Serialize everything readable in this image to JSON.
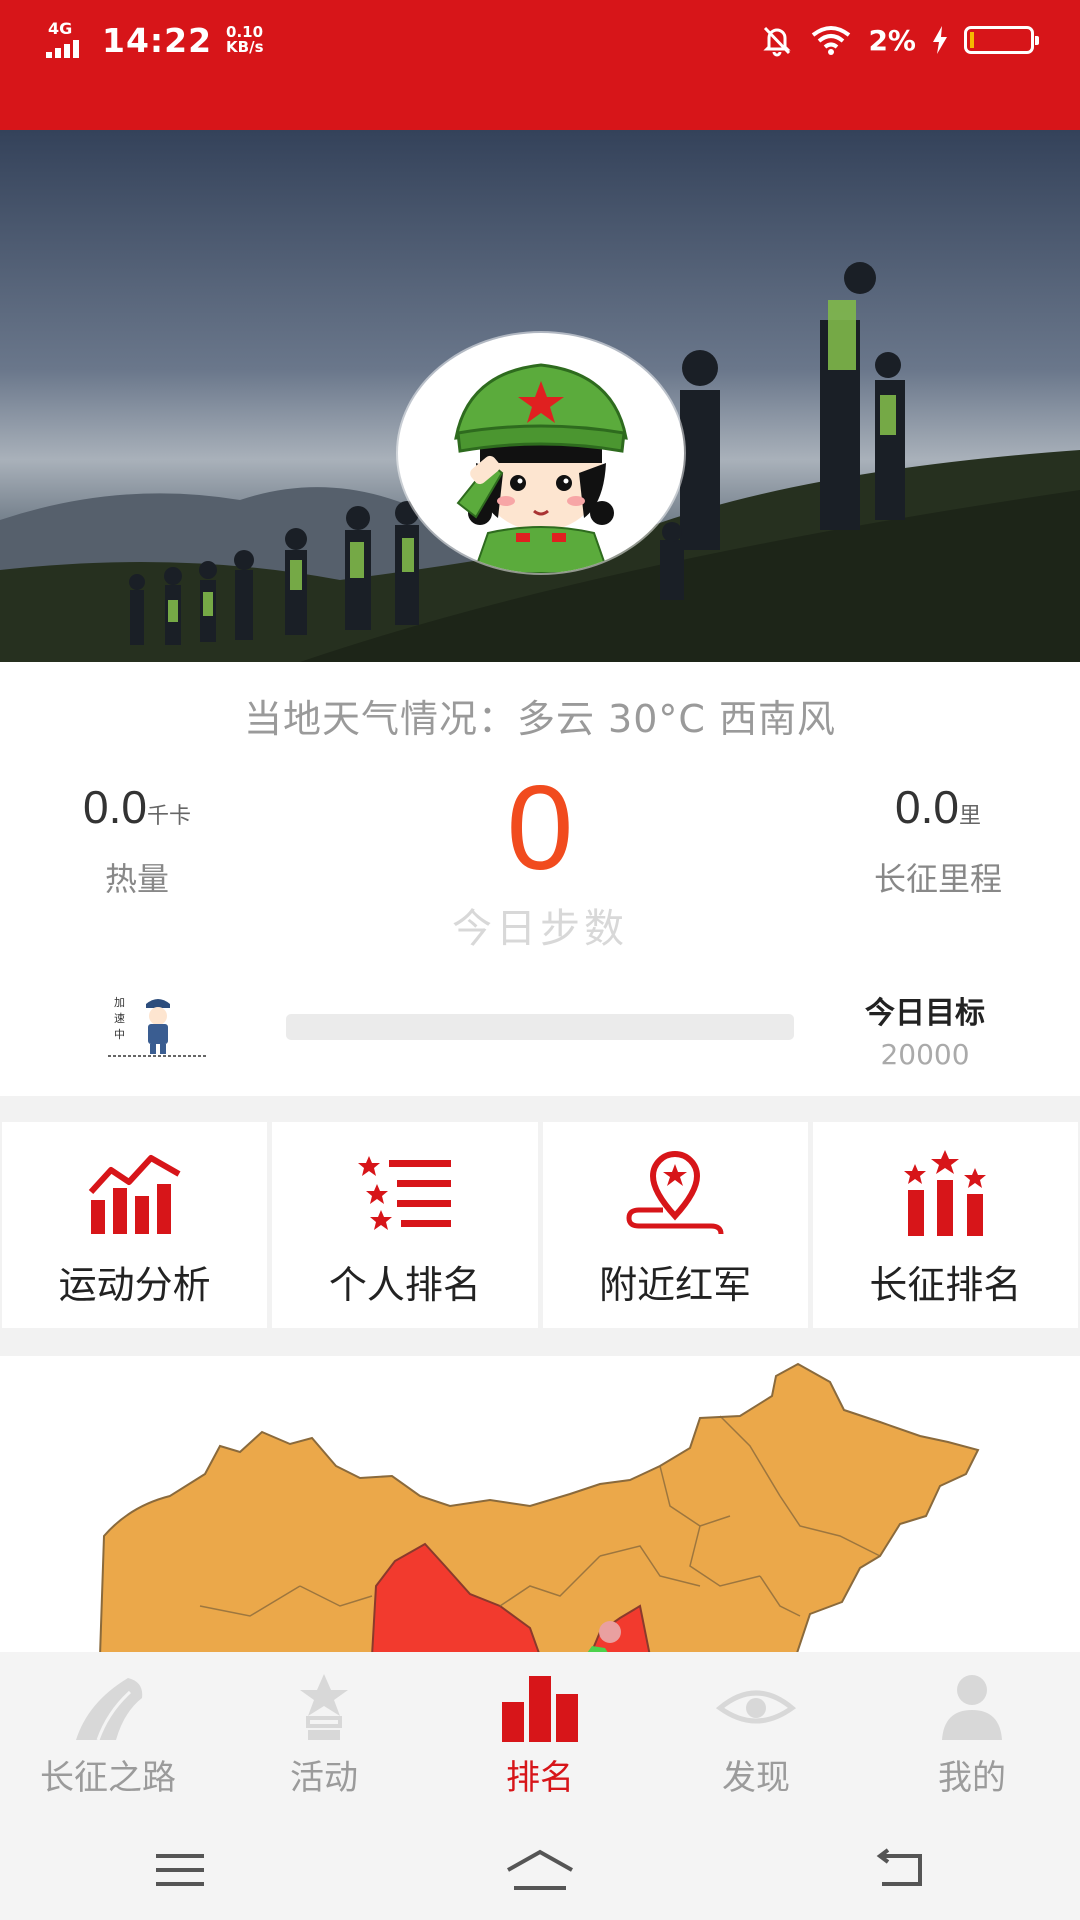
{
  "status_bar": {
    "network": "4G",
    "time": "14:22",
    "speed_value": "0.10",
    "speed_unit": "KB/s",
    "battery_pct": "2%",
    "battery_level": 0.02
  },
  "stats": {
    "weather": "当地天气情况：多云 30°C 西南风",
    "calories_value": "0.0",
    "calories_unit": "千卡",
    "calories_label": "热量",
    "steps_value": "0",
    "steps_label": "今日步数",
    "distance_value": "0.0",
    "distance_unit": "里",
    "distance_label": "长征里程",
    "goal_label": "今日目标",
    "goal_value": "20000",
    "progress": 0.0
  },
  "menu": [
    {
      "label": "运动分析",
      "icon": "chart-icon"
    },
    {
      "label": "个人排名",
      "icon": "star-list-icon"
    },
    {
      "label": "附近红军",
      "icon": "location-star-icon"
    },
    {
      "label": "长征排名",
      "icon": "podium-stars-icon"
    }
  ],
  "bottom_nav": [
    {
      "label": "长征之路",
      "icon": "road-icon",
      "active": false
    },
    {
      "label": "活动",
      "icon": "star-badge-icon",
      "active": false
    },
    {
      "label": "排名",
      "icon": "ranking-bars-icon",
      "active": true
    },
    {
      "label": "发现",
      "icon": "eye-icon",
      "active": false
    },
    {
      "label": "我的",
      "icon": "person-icon",
      "active": false
    }
  ],
  "colors": {
    "brand_red": "#d71519",
    "steps_orange": "#f14b1e",
    "map_orange": "#eba84a",
    "map_red": "#f23a2e"
  }
}
